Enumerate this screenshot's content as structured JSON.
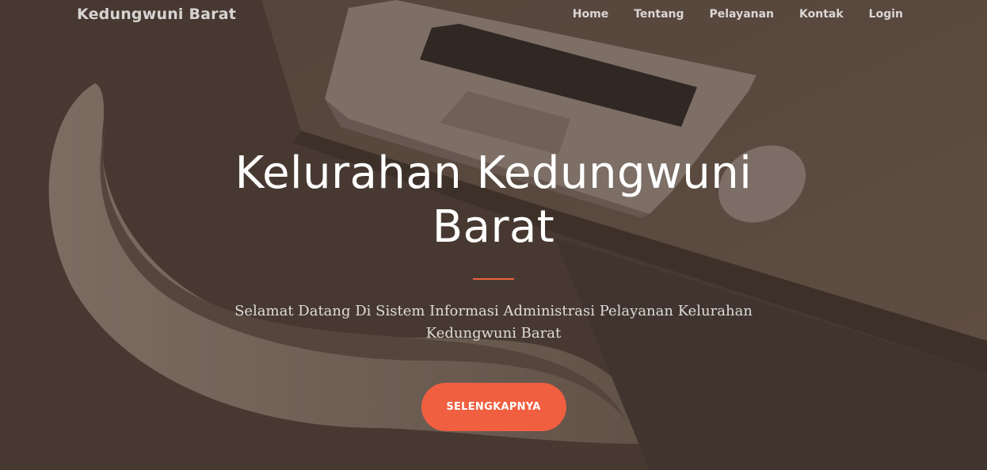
{
  "navbar": {
    "brand": "Kedungwuni Barat",
    "links": [
      {
        "label": "Home"
      },
      {
        "label": "Tentang"
      },
      {
        "label": "Pelayanan"
      },
      {
        "label": "Kontak"
      },
      {
        "label": "Login"
      }
    ]
  },
  "hero": {
    "title": "Kelurahan Kedungwuni Barat",
    "subtitle": "Selamat Datang Di Sistem Informasi Administrasi Pelayanan Kelurahan Kedungwuni Barat",
    "cta_label": "SELENGKAPNYA"
  },
  "colors": {
    "accent": "#f05f40",
    "background": "#4f4037"
  }
}
